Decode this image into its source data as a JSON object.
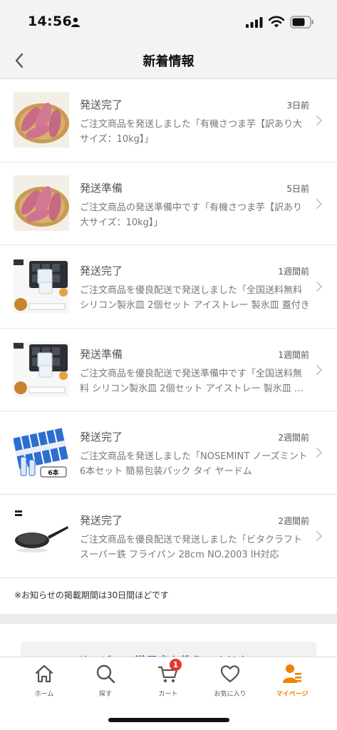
{
  "status_bar": {
    "time": "14:56"
  },
  "nav": {
    "title": "新着情報"
  },
  "notifications": [
    {
      "status": "発送完了",
      "time": "3日前",
      "body": "ご注文商品を発送しました「有機さつま芋【訳あり大サイズ：10kg】」",
      "thumb": "sweet-potato"
    },
    {
      "status": "発送準備",
      "time": "5日前",
      "body": "ご注文商品の発送準備中です「有機さつま芋【訳あり大サイズ：10kg】」",
      "thumb": "sweet-potato"
    },
    {
      "status": "発送完了",
      "time": "1週間前",
      "body": "ご注文商品を優良配送で発送しました「全国送料無料 シリコン製氷皿 2個セット アイストレー 製氷皿 蓋付き",
      "thumb": "ice-tray"
    },
    {
      "status": "発送準備",
      "time": "1週間前",
      "body": "ご注文商品を優良配送で発送準備中です「全国送料無料 シリコン製氷皿 2個セット アイストレー 製氷皿 蓋付き",
      "thumb": "ice-tray"
    },
    {
      "status": "発送完了",
      "time": "2週間前",
      "body": "ご注文商品を発送しました「NOSEMINT ノーズミント 6本セット 簡易包装パック タイ ヤードム",
      "thumb": "nosemint"
    },
    {
      "status": "発送完了",
      "time": "2週間前",
      "body": "ご注文商品を優良配送で発送しました「ビタクラフト スーパー鉄 フライパン 28cm NO.2003 IH対応",
      "thumb": "frying-pan"
    }
  ],
  "notice": "※お知らせの掲載期間は30日間ほどです",
  "survey": {
    "text": "サービスの満足度を教えてください"
  },
  "tabs": [
    {
      "label": "ホーム",
      "icon": "home-icon"
    },
    {
      "label": "探す",
      "icon": "search-icon"
    },
    {
      "label": "カート",
      "icon": "cart-icon",
      "badge": "1"
    },
    {
      "label": "お気に入り",
      "icon": "heart-icon"
    },
    {
      "label": "マイページ",
      "icon": "person-icon",
      "active": true
    }
  ],
  "colors": {
    "accent": "#f08100",
    "badge": "#e33a2c",
    "link": "#2a6fd1"
  }
}
